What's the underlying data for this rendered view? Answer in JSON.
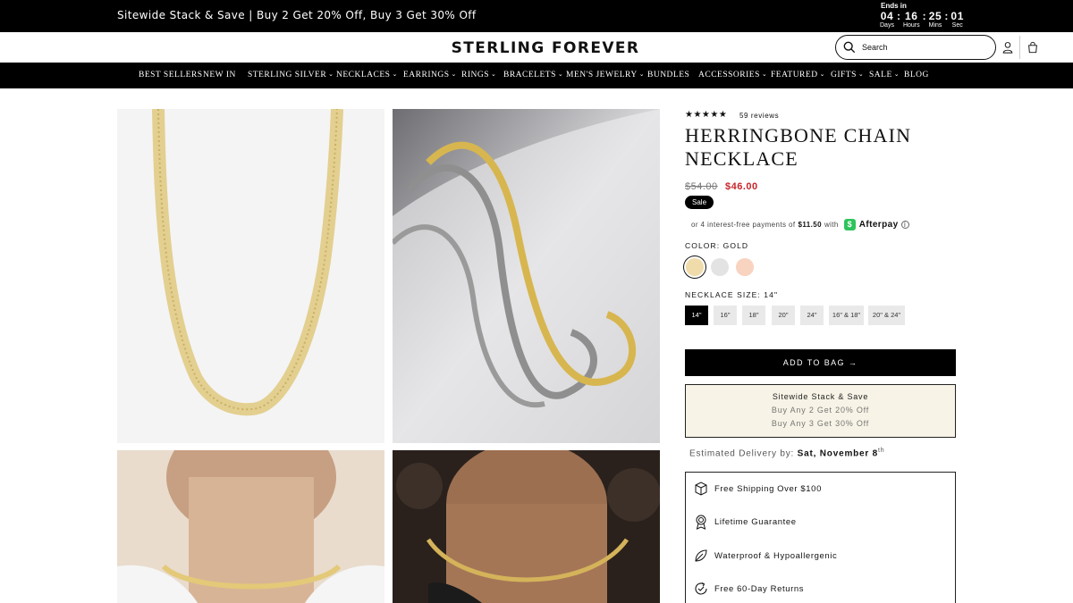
{
  "promo": {
    "text": "Sitewide Stack & Save | Buy 2 Get 20% Off, Buy 3 Get 30% Off",
    "countdown": {
      "ends_label": "Ends in",
      "days": "04",
      "hours": "16",
      "mins": "25",
      "secs": "01",
      "days_label": "Days",
      "hours_label": "Hours",
      "mins_label": "Mins",
      "secs_label": "Sec"
    }
  },
  "header": {
    "logo": "STERLING FOREVER",
    "search_placeholder": "Search",
    "icons": [
      "search-icon",
      "account-icon",
      "bag-icon"
    ]
  },
  "nav": {
    "items": [
      {
        "label": "BEST SELLERS",
        "dropdown": false
      },
      {
        "label": "NEW IN",
        "dropdown": false
      },
      {
        "label": "STERLING SILVER",
        "dropdown": true
      },
      {
        "label": "NECKLACES",
        "dropdown": true
      },
      {
        "label": "EARRINGS",
        "dropdown": true
      },
      {
        "label": "RINGS",
        "dropdown": true
      },
      {
        "label": "BRACELETS",
        "dropdown": true
      },
      {
        "label": "MEN'S JEWELRY",
        "dropdown": true
      },
      {
        "label": "BUNDLES",
        "dropdown": false
      },
      {
        "label": "ACCESSORIES",
        "dropdown": true
      },
      {
        "label": "FEATURED",
        "dropdown": true
      },
      {
        "label": "GIFTS",
        "dropdown": true
      },
      {
        "label": "SALE",
        "dropdown": true
      },
      {
        "label": "BLOG",
        "dropdown": false
      }
    ]
  },
  "product": {
    "stars": "★★★★★",
    "reviews": "59 reviews",
    "title_line1": "HERRINGBONE CHAIN",
    "title_line2": "NECKLACE",
    "old_price": "$54.00",
    "new_price": "$46.00",
    "sale_badge": "Sale",
    "afterpay": {
      "prefix": "or 4 interest-free payments of",
      "amount": "$11.50",
      "with": "with",
      "brand": "Afterpay",
      "info": "i"
    },
    "color_label": "COLOR: GOLD",
    "colors": [
      {
        "name": "Gold",
        "hex": "#f0dcaa",
        "selected": true
      },
      {
        "name": "Silver",
        "hex": "#e3e3e3",
        "selected": false
      },
      {
        "name": "Rose Gold",
        "hex": "#f7d3c0",
        "selected": false
      }
    ],
    "size_label": "NECKLACE SIZE: 14\"",
    "sizes": [
      {
        "label": "14\"",
        "selected": true
      },
      {
        "label": "16\"",
        "selected": false
      },
      {
        "label": "18\"",
        "selected": false
      },
      {
        "label": "20\"",
        "selected": false
      },
      {
        "label": "24\"",
        "selected": false
      },
      {
        "label": "16\" & 18\"",
        "selected": false
      },
      {
        "label": "20\" & 24\"",
        "selected": false
      }
    ],
    "add_to_bag": "ADD TO BAG →",
    "stack": {
      "title": "Sitewide Stack & Save",
      "line1": "Buy Any 2 Get 20% Off",
      "line2": "Buy Any 3 Get 30% Off"
    },
    "delivery": {
      "label": "Estimated Delivery by:",
      "date": "Sat, November 8",
      "suffix": "th"
    },
    "perks": [
      {
        "icon": "box-icon",
        "label": "Free Shipping Over $100"
      },
      {
        "icon": "ribbon-icon",
        "label": "Lifetime Guarantee"
      },
      {
        "icon": "leaf-icon",
        "label": "Waterproof & Hypoallergenic"
      },
      {
        "icon": "return-icon",
        "label": "Free 60-Day Returns"
      }
    ]
  },
  "colors": {
    "bar_bg": "#000000",
    "sale_red": "#c8242a",
    "afterpay_green": "#2ec35c",
    "stack_bg": "#f7f3e6"
  }
}
